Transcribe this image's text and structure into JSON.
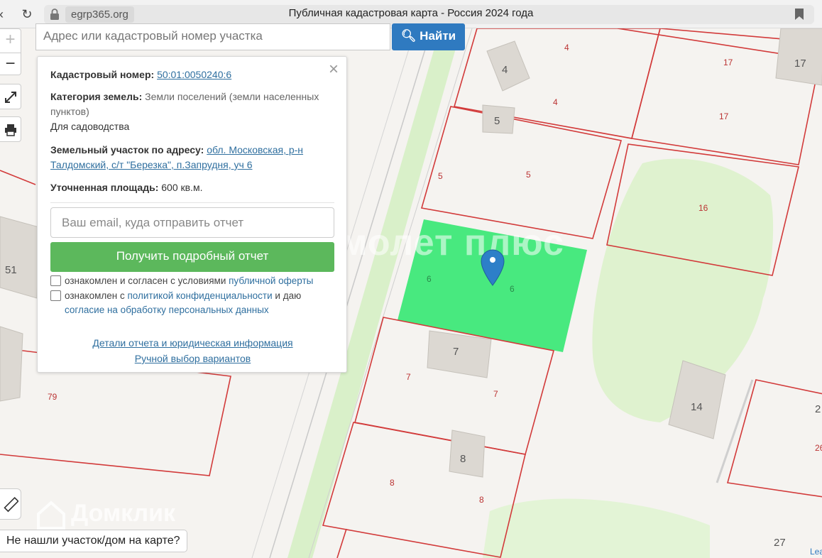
{
  "browser": {
    "domain": "egrp365.org",
    "title": "Публичная кадастровая карта - Россия 2024 года"
  },
  "search": {
    "placeholder": "Адрес или кадастровый номер участка",
    "button": "Найти"
  },
  "controls": {
    "zoom_in": "+",
    "zoom_out": "−"
  },
  "popup": {
    "cad_label": "Кадастровый номер:",
    "cad_value": "50:01:0050240:6",
    "cat_label": "Категория земель:",
    "cat_value": "Земли поселений (земли населенных пунктов)",
    "use": "Для садоводства",
    "addr_label": "Земельный участок по адресу:",
    "addr_value": "обл. Московская, р-н Талдомский, с/т \"Березка\", п.Запрудня, уч 6",
    "area_label": "Уточненная площадь:",
    "area_value": "600 кв.м.",
    "email_placeholder": "Ваш email, куда отправить отчет",
    "report_button": "Получить подробный отчет",
    "consent1_a": "ознакомлен и согласен с условиями",
    "consent1_link": "публичной оферты",
    "consent2_a": "ознакомлен с",
    "consent2_link1": "политикой конфиденциальности",
    "consent2_b": "и даю",
    "consent2_link2": "согласие на обработку персональных данных",
    "details_link": "Детали отчета и юридическая информация",
    "manual_link": "Ручной выбор вариантов"
  },
  "map": {
    "building_labels": [
      "4",
      "17",
      "5",
      "51",
      "7",
      "8",
      "14",
      "2",
      "27"
    ],
    "parcel_labels": [
      "4",
      "4",
      "17",
      "17",
      "5",
      "5",
      "16",
      "6",
      "6",
      "7",
      "7",
      "8",
      "8",
      "79",
      "26"
    ],
    "watermark": "Самолет плюс",
    "watermark_bottom": "Домклик",
    "attribution": "Lea",
    "not_found": "Не нашли участок/дом на карте?",
    "colors": {
      "parcel_border": "#d23a3a",
      "selected_parcel": "#3ee878",
      "green_area": "#d9f0c9",
      "marker": "#2d7fc8"
    }
  }
}
